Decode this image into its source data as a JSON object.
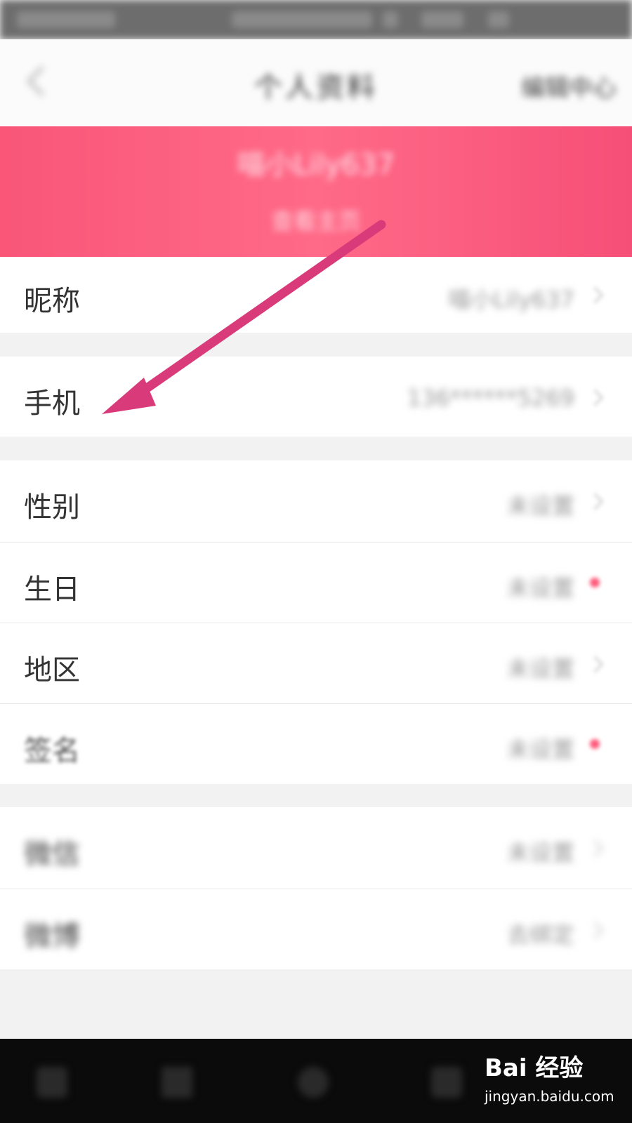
{
  "header": {
    "title": "个人资料",
    "right_action": "编辑中心"
  },
  "banner": {
    "username": "喵小Lily637",
    "subtitle": "查看主页"
  },
  "rows": [
    {
      "label": "昵称",
      "value": "喵小Lily637"
    },
    {
      "label": "手机",
      "value": "136******5269"
    },
    {
      "label": "性别",
      "value": "未设置"
    },
    {
      "label": "生日",
      "value": "未设置"
    },
    {
      "label": "地区",
      "value": "未设置"
    },
    {
      "label": "签名",
      "value": "未设置"
    },
    {
      "label": "微信",
      "value": "未设置"
    },
    {
      "label": "微博",
      "value": "去绑定"
    }
  ],
  "watermark": {
    "brand": "Bai 经验",
    "url": "jingyan.baidu.com"
  },
  "colors": {
    "banner": "#f95678",
    "arrow": "#d93a7a",
    "accent_dot": "#ff5a7a"
  }
}
